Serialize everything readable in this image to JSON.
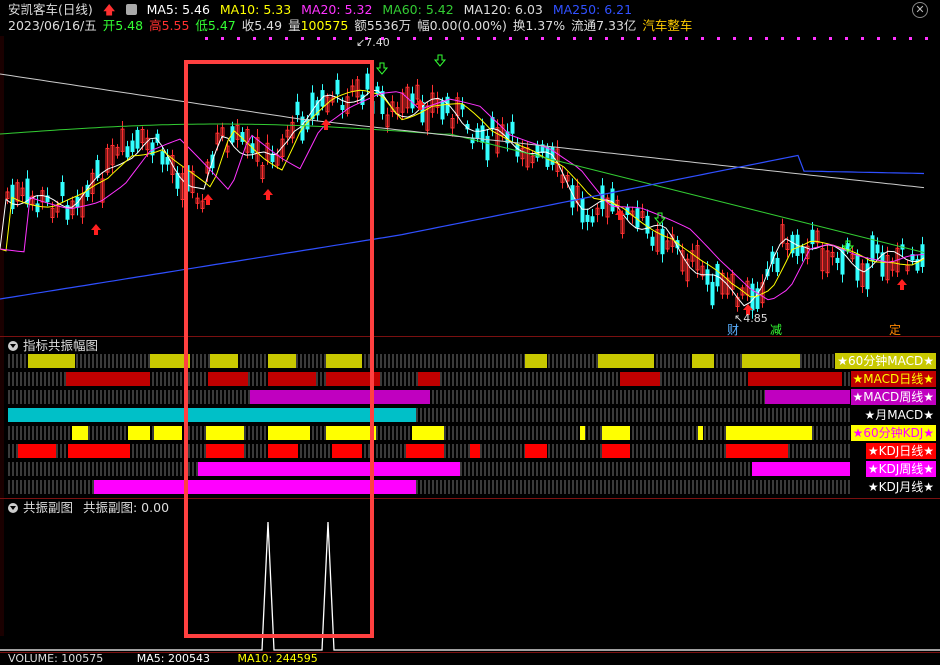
{
  "header": {
    "stock_name": "安凯客车",
    "period": "(日线)",
    "ma5_label": "MA5: 5.46",
    "ma10_label": "MA10: 5.33",
    "ma20_label": "MA20: 5.32",
    "ma60_label": "MA60: 5.42",
    "ma120_label": "MA120: 6.03",
    "ma250_label": "MA250: 6.21",
    "date": "2023/06/16/五",
    "open": "开5.48",
    "high": "高5.55",
    "low": "低5.47",
    "close": "收5.49",
    "volume_label": "量",
    "volume_value": "100575",
    "amount": "额5536万",
    "change": "幅0.00(0.00%)",
    "turnover": "换1.37%",
    "float_cap": "流通7.33亿",
    "sector": "汽车整车"
  },
  "colors": {
    "ma5": "#ffffff",
    "ma10": "#ffff00",
    "ma20": "#ff33ff",
    "ma60": "#33cc33",
    "ma120": "#cccccc",
    "ma250": "#2f4fff",
    "candle_up": "#ff3030",
    "candle_down": "#33ffff",
    "highlight_box": "#ff4040"
  },
  "price_annotations": {
    "high_label": "7.40",
    "low_label": "4.85",
    "tag_cai": "财",
    "tag_jian": "减",
    "tag_ding": "定"
  },
  "resonance_panel": {
    "title": "指标共振幅图",
    "bands": [
      {
        "label": "60分钟MACD",
        "color": "#c8c800"
      },
      {
        "label": "MACD日线",
        "color": "#c00000"
      },
      {
        "label": "MACD周线",
        "color": "#c000c0"
      },
      {
        "label": "月MACD",
        "color": "#00c0c8"
      },
      {
        "label": "60分钟KDJ",
        "color": "#ffff00"
      },
      {
        "label": "KDJ日线",
        "color": "#ff0000"
      },
      {
        "label": "KDJ周线",
        "color": "#ff00ff"
      },
      {
        "label": "KDJ月线",
        "color": "#ff00ff"
      }
    ]
  },
  "sub_panel": {
    "title": "共振副图",
    "value_label": "共振副图: 0.00"
  },
  "volume_panel": {
    "label": "VOLUME: 100575",
    "ma5_label": "MA5: 200543",
    "ma10_label": "MA10: 244595"
  }
}
